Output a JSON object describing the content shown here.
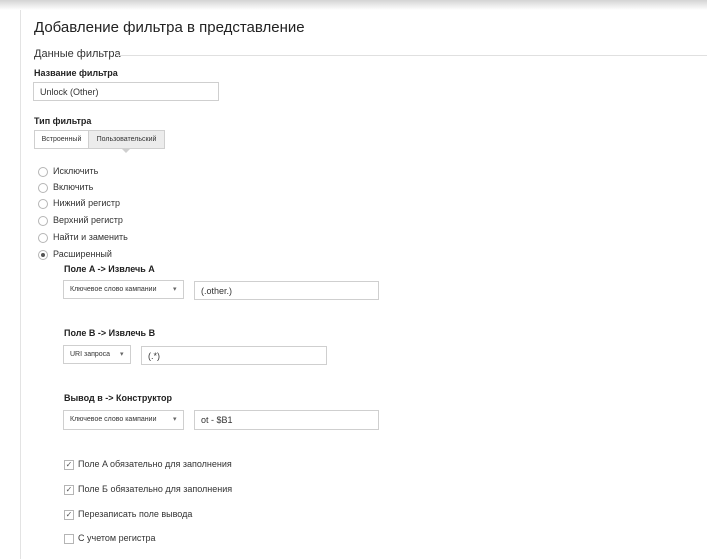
{
  "page": {
    "title": "Добавление фильтра в представление"
  },
  "section": {
    "label": "Данные фильтра"
  },
  "filter_name": {
    "label": "Название фильтра",
    "value": "Unlock (Other)"
  },
  "filter_type": {
    "label": "Тип фильтра",
    "tabs": [
      {
        "label": "Встроенный",
        "active": false
      },
      {
        "label": "Пользовательский",
        "active": true
      }
    ]
  },
  "options": [
    {
      "label": "Исключить",
      "checked": false
    },
    {
      "label": "Включить",
      "checked": false
    },
    {
      "label": "Нижний регистр",
      "checked": false
    },
    {
      "label": "Верхний регистр",
      "checked": false
    },
    {
      "label": "Найти и заменить",
      "checked": false
    },
    {
      "label": "Расширенный",
      "checked": true
    }
  ],
  "field_a": {
    "label": "Поле A -> Извлечь A",
    "dropdown": "Ключевое слово кампании",
    "value": "(.other.)"
  },
  "field_b": {
    "label": "Поле B -> Извлечь B",
    "dropdown": "URI запроса",
    "value": "(.*)"
  },
  "output": {
    "label": "Вывод в -> Конструктор",
    "dropdown": "Ключевое слово кампании",
    "value": "ot - $B1"
  },
  "checkboxes": [
    {
      "label": "Поле A обязательно для заполнения",
      "checked": true
    },
    {
      "label": "Поле Б обязательно для заполнения",
      "checked": true
    },
    {
      "label": "Перезаписать поле вывода",
      "checked": true
    },
    {
      "label": "С учетом регистра",
      "checked": false
    }
  ],
  "icons": {
    "dropdown_arrow": "▾",
    "checkmark": "✓"
  }
}
